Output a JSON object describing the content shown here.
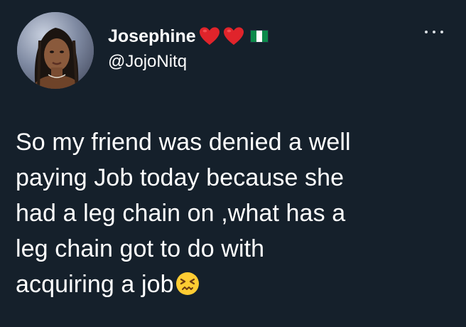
{
  "user": {
    "display_name": "Josephine",
    "handle": "@JojoNitq",
    "name_emojis": [
      "red-heart-icon",
      "red-heart-icon",
      "nigeria-flag-icon"
    ]
  },
  "tweet": {
    "lines": [
      "So my friend was denied a well",
      "paying Job today because she",
      "had a leg chain on ,what has a",
      "leg chain got to do with",
      "acquiring a job"
    ],
    "trailing_emoji": "confounded-face-icon"
  },
  "colors": {
    "background": "#15202b",
    "text": "#ffffff",
    "heart": "#e0242b",
    "flag_green": "#0b8a4a",
    "flag_white": "#ffffff",
    "emoji_yellow": "#ffcc33"
  },
  "menu": {
    "icon": "more-options-icon"
  }
}
